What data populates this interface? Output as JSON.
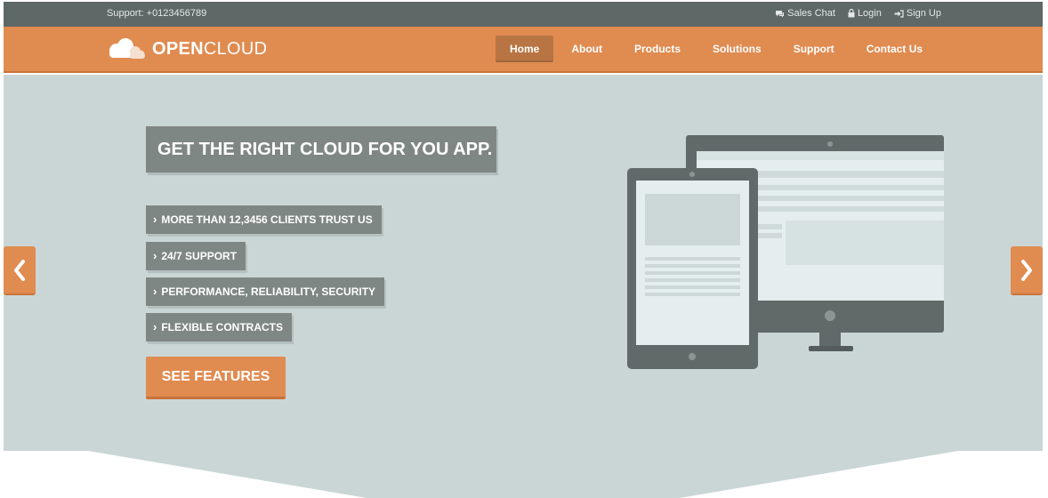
{
  "topbar": {
    "support": "Support: +0123456789",
    "links": [
      {
        "label": "Sales Chat",
        "icon": "chat-icon"
      },
      {
        "label": "Login",
        "icon": "lock-icon"
      },
      {
        "label": "Sign Up",
        "icon": "sign-in-icon"
      }
    ]
  },
  "brand": {
    "bold": "OPEN",
    "light": "CLOUD",
    "icon": "cloud-icon"
  },
  "nav": {
    "items": [
      "Home",
      "About",
      "Products",
      "Solutions",
      "Support",
      "Contact Us"
    ],
    "active": "Home"
  },
  "hero": {
    "title": "GET THE RIGHT CLOUD FOR YOU APP.",
    "features": [
      "MORE THAN 12,3456 CLIENTS TRUST US",
      "24/7 SUPPORT",
      "PERFORMANCE, RELIABILITY, SECURITY",
      "FLEXIBLE CONTRACTS"
    ],
    "feature_icon": "chevron-right-icon",
    "cta": "SEE FEATURES"
  },
  "carousel": {
    "prev_icon": "chevron-left-icon",
    "next_icon": "chevron-right-icon"
  },
  "colors": {
    "topbar_bg": "#5e6866",
    "accent": "#e08b50",
    "hero_bg": "#cad6d6",
    "label_bg": "#7f8785",
    "device": "#606a68"
  }
}
